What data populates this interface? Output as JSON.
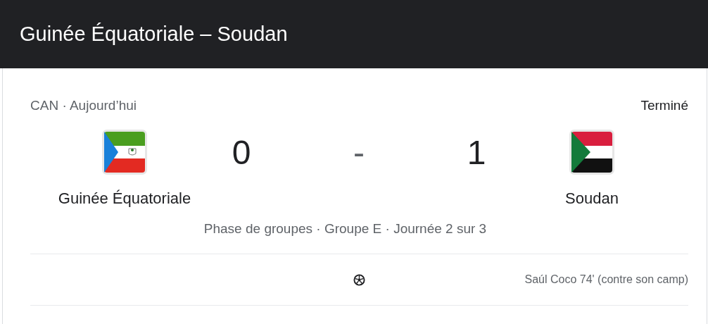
{
  "window": {
    "title": "Guinée Équatoriale – Soudan"
  },
  "match": {
    "competition": "CAN · Aujourd’hui",
    "status": "Terminé",
    "teams": [
      {
        "name": "Guinée Équatoriale",
        "score": "0"
      },
      {
        "name": "Soudan",
        "score": "1"
      }
    ],
    "separator": "-",
    "stage": "Phase de groupes · Groupe E · Journée 2 sur 3"
  },
  "goals": [
    {
      "scorer": "Saúl Coco 74' (contre son camp)"
    }
  ]
}
